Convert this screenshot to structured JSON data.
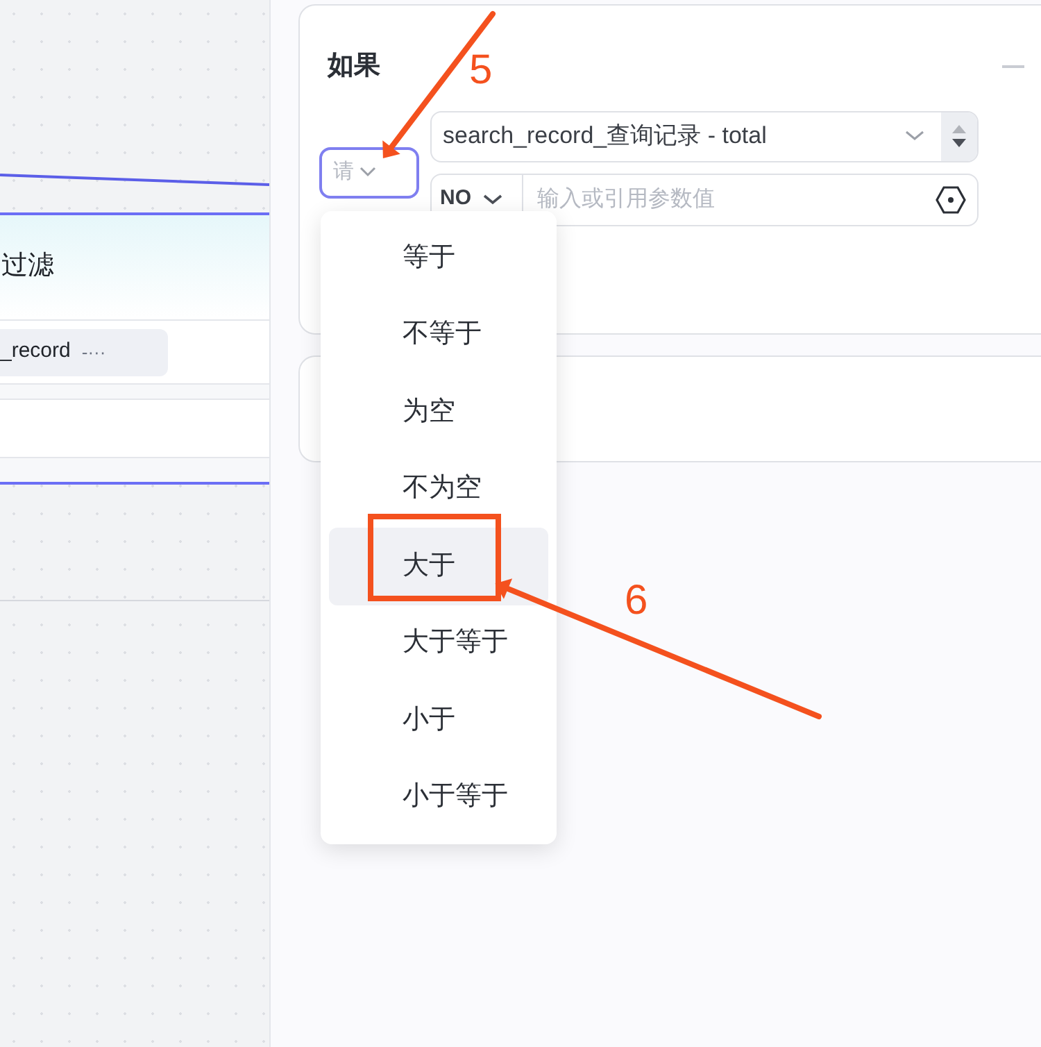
{
  "canvas": {
    "node": {
      "title": "过滤",
      "chip": "_record",
      "chip_suffix": "-···"
    }
  },
  "panel": {
    "condition": {
      "title": "如果",
      "operator_select": {
        "placeholder": "请"
      },
      "left_operand": {
        "value": "search_record_查询记录 - total"
      },
      "type_select": {
        "value": "NO"
      },
      "value_input": {
        "placeholder": "输入或引用参数值"
      }
    },
    "operator_menu": [
      {
        "label": "等于",
        "selected": false
      },
      {
        "label": "不等于",
        "selected": false
      },
      {
        "label": "为空",
        "selected": false
      },
      {
        "label": "不为空",
        "selected": false
      },
      {
        "label": "大于",
        "selected": true
      },
      {
        "label": "大于等于",
        "selected": false
      },
      {
        "label": "小于",
        "selected": false
      },
      {
        "label": "小于等于",
        "selected": false
      }
    ]
  },
  "annotations": [
    {
      "kind": "arrow",
      "label": "5"
    },
    {
      "kind": "arrow",
      "label": "6"
    },
    {
      "kind": "box"
    }
  ]
}
